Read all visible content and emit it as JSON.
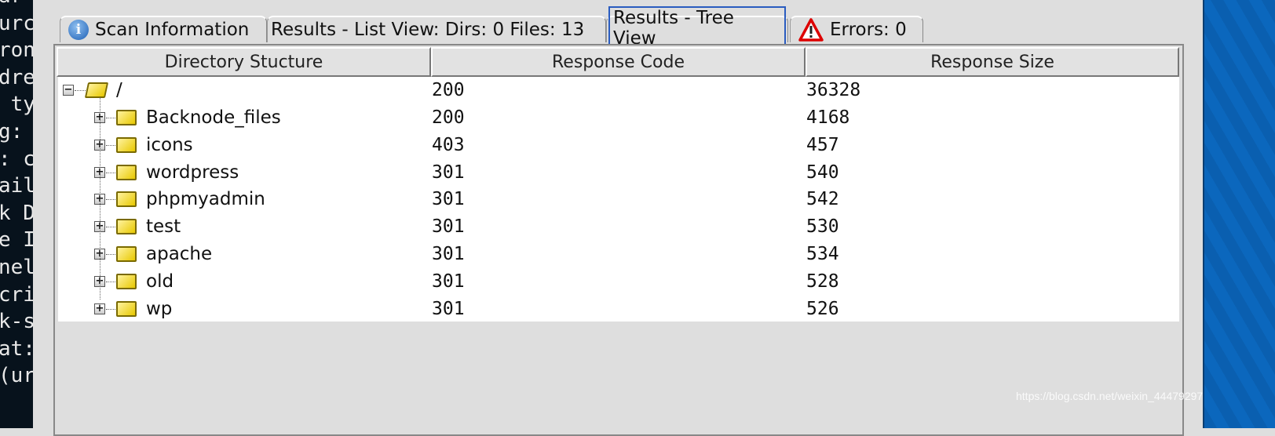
{
  "terminal": {
    "lines": [
      "ar",
      "urc",
      "ron",
      "dre",
      " ty",
      "g:",
      ": c",
      "ail",
      "k D",
      "e I",
      "nel",
      "",
      "cri",
      "k-s",
      "at:",
      "(ur"
    ]
  },
  "tabs": [
    {
      "label": "Scan Information",
      "icon": "info-icon"
    },
    {
      "label": "Results - List View: Dirs: 0 Files: 13"
    },
    {
      "label": "Results - Tree View",
      "selected": true
    },
    {
      "label": "Errors: 0",
      "icon": "warning-icon"
    }
  ],
  "table": {
    "columns": [
      "Directory Stucture",
      "Response Code",
      "Response Size"
    ],
    "root": {
      "name": "/",
      "code": "200",
      "size": "36328"
    },
    "rows": [
      {
        "name": "Backnode_files",
        "code": "200",
        "size": "4168"
      },
      {
        "name": "icons",
        "code": "403",
        "size": "457"
      },
      {
        "name": "wordpress",
        "code": "301",
        "size": "540"
      },
      {
        "name": "phpmyadmin",
        "code": "301",
        "size": "542"
      },
      {
        "name": "test",
        "code": "301",
        "size": "530"
      },
      {
        "name": "apache",
        "code": "301",
        "size": "534"
      },
      {
        "name": "old",
        "code": "301",
        "size": "528"
      },
      {
        "name": "wp",
        "code": "301",
        "size": "526"
      }
    ]
  },
  "watermark": "https://blog.csdn.net/weixin_44479297"
}
